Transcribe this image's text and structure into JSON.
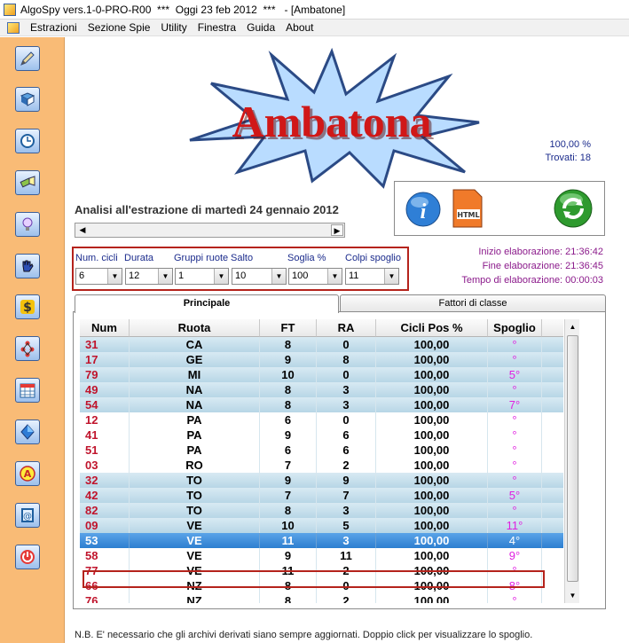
{
  "window": {
    "title": "AlgoSpy vers.1-0-PRO-R00  ***  Oggi 23 feb 2012  ***   - [Ambatone]"
  },
  "menubar": {
    "items": [
      "Estrazioni",
      "Sezione Spie",
      "Utility",
      "Finestra",
      "Guida",
      "About"
    ]
  },
  "sidebar": {
    "icons": [
      "pencil-icon",
      "book-icon",
      "clock-icon",
      "flashlight-icon",
      "lightbulb-icon",
      "hand-icon",
      "dollar-icon",
      "network-icon",
      "calendar-icon",
      "diamond-icon",
      "a-badge-icon",
      "email-icon",
      "power-icon"
    ]
  },
  "banner": {
    "text": "Ambatona"
  },
  "stats": {
    "percent": "100,00 %",
    "found": "Trovati: 18"
  },
  "analysis": {
    "title": "Analisi all'estrazione di martedì 24 gennaio 2012"
  },
  "times": {
    "start": "Inizio elaborazione: 21:36:42",
    "end": "Fine elaborazione: 21:36:45",
    "elapsed": "Tempo di elaborazione: 00:00:03"
  },
  "params": {
    "labels": {
      "num_cicli": "Num. cicli",
      "durata": "Durata",
      "gruppi_ruote": "Gruppi ruote",
      "salto": "Salto",
      "soglia": "Soglia %",
      "colpi_spoglio": "Colpi spoglio"
    },
    "values": {
      "num_cicli": "6",
      "durata": "12",
      "gruppi_ruote": "1",
      "salto": "10",
      "soglia": "100",
      "colpi_spoglio": "11"
    }
  },
  "tabs": {
    "principale": "Principale",
    "fattori": "Fattori di classe"
  },
  "table": {
    "headers": [
      "Num",
      "Ruota",
      "FT",
      "RA",
      "Cicli Pos %",
      "Spoglio"
    ],
    "rows": [
      [
        "31",
        "CA",
        "8",
        "0",
        "100,00",
        "°"
      ],
      [
        "17",
        "GE",
        "9",
        "8",
        "100,00",
        "°"
      ],
      [
        "79",
        "MI",
        "10",
        "0",
        "100,00",
        "5°"
      ],
      [
        "49",
        "NA",
        "8",
        "3",
        "100,00",
        "°"
      ],
      [
        "54",
        "NA",
        "8",
        "3",
        "100,00",
        "7°"
      ],
      [
        "12",
        "PA",
        "6",
        "0",
        "100,00",
        "°"
      ],
      [
        "41",
        "PA",
        "9",
        "6",
        "100,00",
        "°"
      ],
      [
        "51",
        "PA",
        "6",
        "6",
        "100,00",
        "°"
      ],
      [
        "03",
        "RO",
        "7",
        "2",
        "100,00",
        "°"
      ],
      [
        "32",
        "TO",
        "9",
        "9",
        "100,00",
        "°"
      ],
      [
        "42",
        "TO",
        "7",
        "7",
        "100,00",
        "5°"
      ],
      [
        "82",
        "TO",
        "8",
        "3",
        "100,00",
        "°"
      ],
      [
        "09",
        "VE",
        "10",
        "5",
        "100,00",
        "11°"
      ],
      [
        "53",
        "VE",
        "11",
        "3",
        "100,00",
        "4°"
      ],
      [
        "58",
        "VE",
        "9",
        "11",
        "100,00",
        "9°"
      ],
      [
        "77",
        "VE",
        "11",
        "2",
        "100,00",
        "°"
      ],
      [
        "66",
        "NZ",
        "8",
        "0",
        "100,00",
        "8°"
      ],
      [
        "76",
        "NZ",
        "8",
        "2",
        "100,00",
        "°"
      ]
    ],
    "selected_index": 13
  },
  "footnote": "N.B. E' necessario che gli archivi derivati siano sempre aggiornati. Doppio click per visualizzare lo spoglio.",
  "colors": {
    "sidebar": "#f9bb76",
    "row_blue": "#c7e0ec",
    "row_white": "#ffffff",
    "selection": "#3b8ddc",
    "num_red": "#c0142c",
    "spoglio_magenta": "#e01ee0",
    "accent_red": "#b5231c"
  }
}
